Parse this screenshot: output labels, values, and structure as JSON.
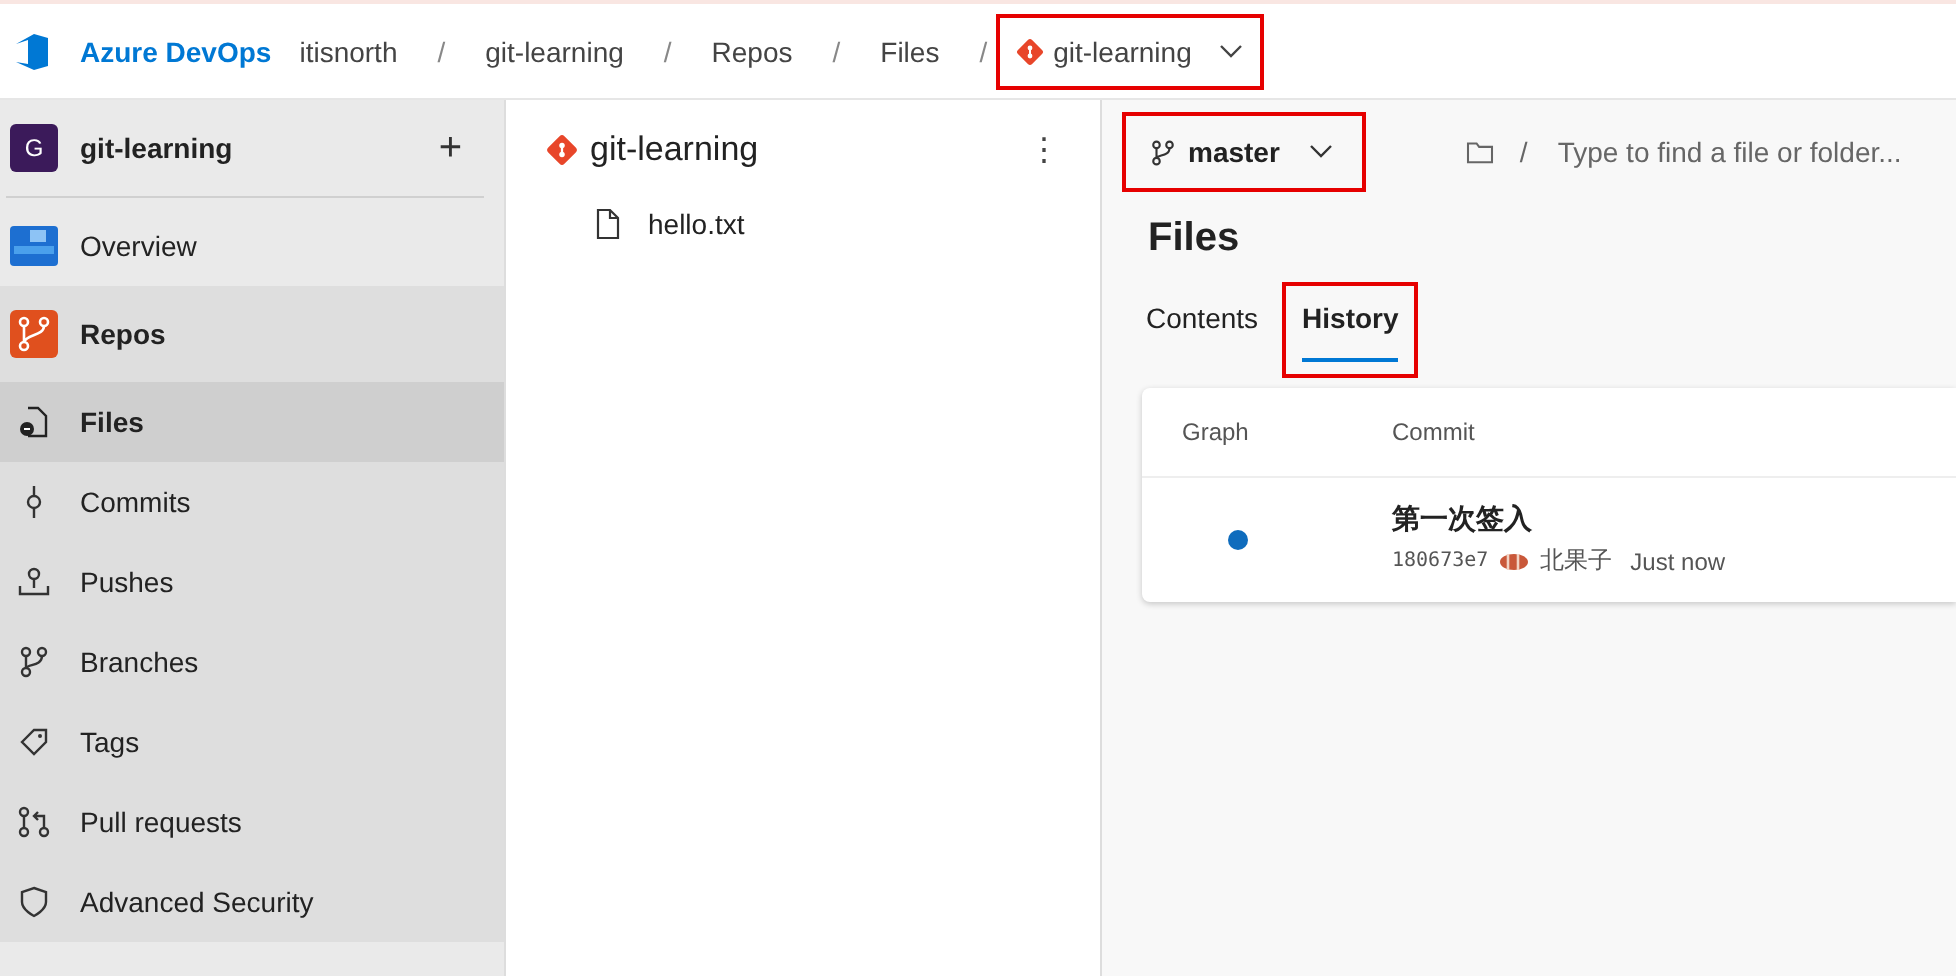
{
  "header": {
    "product": "Azure DevOps",
    "breadcrumbs": [
      {
        "label": "itisnorth",
        "kind": "text",
        "highlighted": false
      },
      {
        "label": "git-learning",
        "kind": "text",
        "highlighted": false
      },
      {
        "label": "Repos",
        "kind": "text",
        "highlighted": false
      },
      {
        "label": "Files",
        "kind": "text",
        "highlighted": false
      },
      {
        "label": "git-learning",
        "kind": "repo",
        "highlighted": true
      }
    ],
    "separator": "/"
  },
  "sidebar": {
    "project": {
      "initial": "G",
      "name": "git-learning",
      "add": "+"
    },
    "items": [
      {
        "label": "Overview",
        "section": false,
        "selected": false
      },
      {
        "label": "Repos",
        "section": true,
        "selected": false
      },
      {
        "label": "Files",
        "section": false,
        "selected": true
      },
      {
        "label": "Commits",
        "section": false,
        "selected": false
      },
      {
        "label": "Pushes",
        "section": false,
        "selected": false
      },
      {
        "label": "Branches",
        "section": false,
        "selected": false
      },
      {
        "label": "Tags",
        "section": false,
        "selected": false
      },
      {
        "label": "Pull requests",
        "section": false,
        "selected": false
      },
      {
        "label": "Advanced Security",
        "section": false,
        "selected": false
      }
    ]
  },
  "tree": {
    "repo": "git-learning",
    "more": "⋮",
    "files": [
      {
        "name": "hello.txt"
      }
    ]
  },
  "main": {
    "branch": {
      "name": "master",
      "highlighted": true
    },
    "path_placeholder": "Type to find a file or folder...",
    "path_separator": "/",
    "title": "Files",
    "tabs": [
      {
        "label": "Contents",
        "selected": false,
        "highlighted": false
      },
      {
        "label": "History",
        "selected": true,
        "highlighted": true
      }
    ],
    "table": {
      "columns": [
        "Graph",
        "Commit"
      ],
      "rows": [
        {
          "message": "第一次签入",
          "hash": "180673e7",
          "author": "北果子",
          "time": "Just now"
        }
      ]
    }
  }
}
